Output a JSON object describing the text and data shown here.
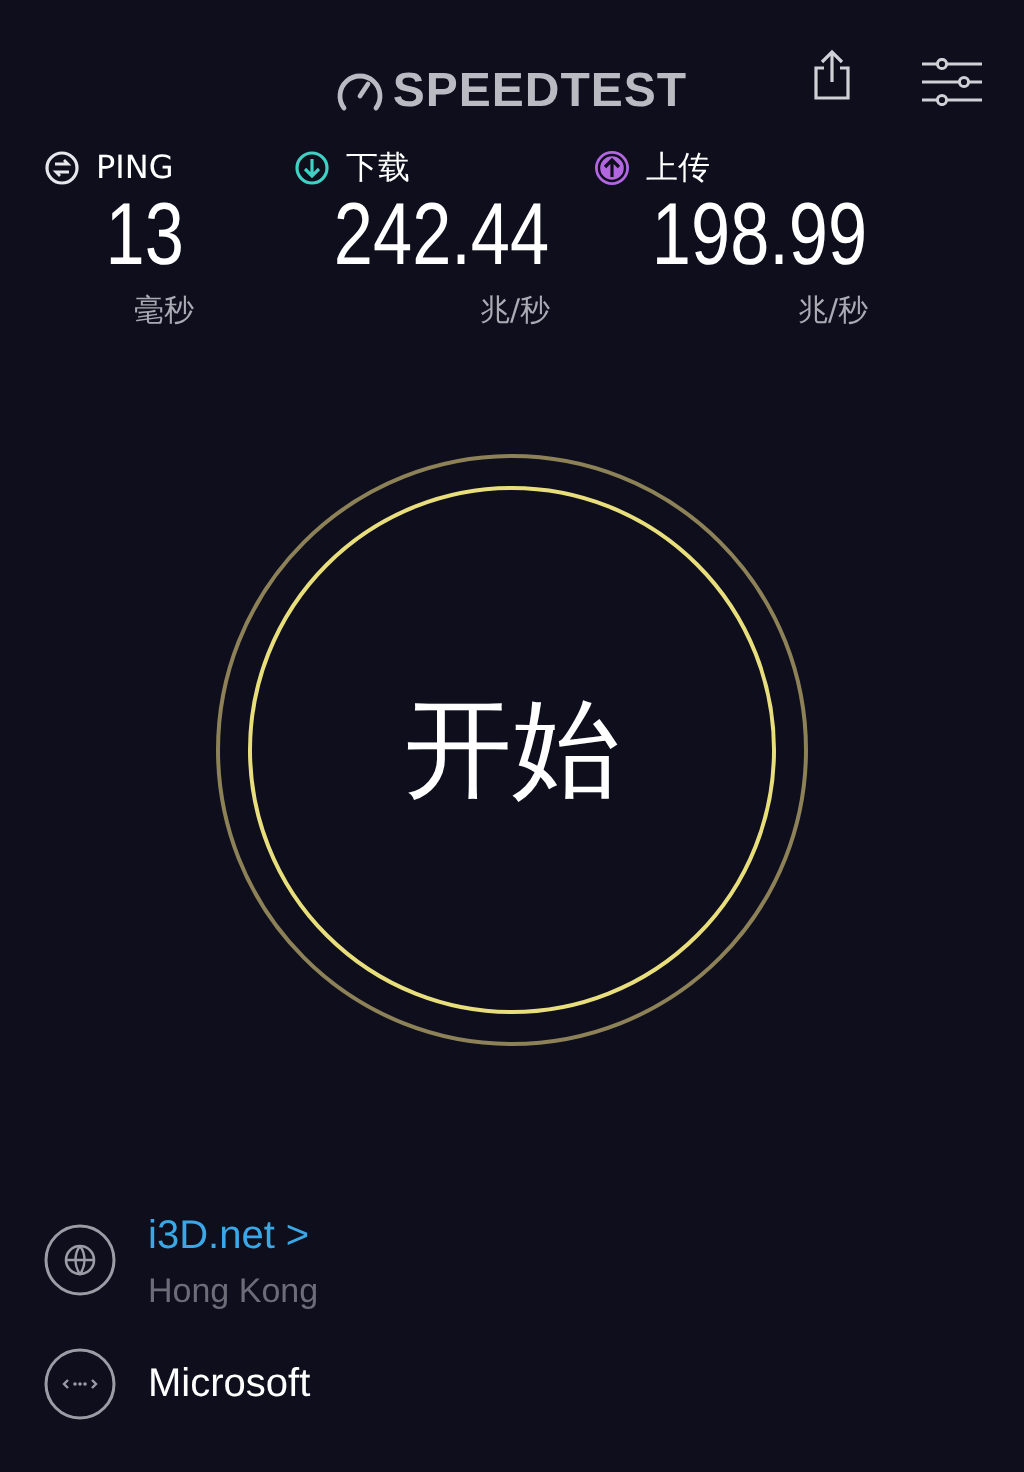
{
  "header": {
    "logo": "SPEEDTEST"
  },
  "metrics": [
    {
      "kind": "ping",
      "label": "PING",
      "value": "13",
      "unit": "毫秒",
      "color": "#e6e6ec"
    },
    {
      "kind": "download",
      "label": "下载",
      "value": "242.44",
      "unit": "兆/秒",
      "color": "#3fd1c4"
    },
    {
      "kind": "upload",
      "label": "上传",
      "value": "198.99",
      "unit": "兆/秒",
      "color": "#b266e0"
    }
  ],
  "start_button": {
    "label": "开始"
  },
  "servers": [
    {
      "kind": "host",
      "name": "i3D.net",
      "arrow": ">",
      "location": "Hong Kong"
    },
    {
      "kind": "provider",
      "name": "Microsoft"
    }
  ]
}
